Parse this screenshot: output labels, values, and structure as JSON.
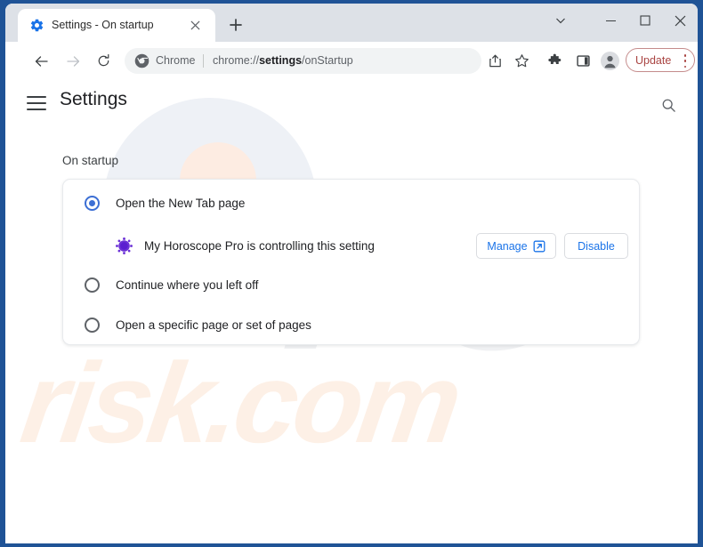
{
  "window": {
    "frame_color": "#1f5396",
    "controls": {
      "chevron": "chevron-down",
      "minimize": "minimize",
      "maximize": "maximize",
      "close": "close"
    }
  },
  "tabstrip": {
    "tabs": [
      {
        "title": "Settings - On startup",
        "favicon": "gear-icon",
        "active": true,
        "close_label": "close-tab"
      }
    ],
    "new_tab_label": "new-tab"
  },
  "toolbar": {
    "back": "back-arrow",
    "forward": "forward-arrow",
    "reload": "reload-icon",
    "omnibox": {
      "site_icon": "chrome-logo",
      "scheme_label": "Chrome",
      "url_prefix": "chrome://",
      "url_bold": "settings",
      "url_suffix": "/onStartup",
      "full_url": "chrome://settings/onStartup"
    },
    "icons": {
      "share": "share-icon",
      "bookmark": "star-icon",
      "extensions": "puzzle-icon",
      "side_panel": "side-panel-icon",
      "profile": "profile-avatar-icon"
    },
    "update_button": {
      "label": "Update",
      "menu_icon": "three-dot-vertical-icon",
      "accent": "#a94442"
    }
  },
  "settings": {
    "menu_label": "hamburger-menu",
    "title": "Settings",
    "search_label": "search-icon",
    "section_title": "On startup",
    "options": [
      {
        "label": "Open the New Tab page",
        "selected": true
      },
      {
        "label": "Continue where you left off",
        "selected": false
      },
      {
        "label": "Open a specific page or set of pages",
        "selected": false
      }
    ],
    "extension_notice": {
      "icon": "extension-starburst-icon",
      "text": "My Horoscope Pro is controlling this setting",
      "manage_label": "Manage",
      "manage_icon": "external-link-icon",
      "disable_label": "Disable",
      "link_color": "#1a73e8"
    }
  },
  "watermark": {
    "logo_text": "PC",
    "domain_text": "risk.com",
    "logo_color": "#f0f1f3",
    "domain_color": "#fdf0e6"
  }
}
